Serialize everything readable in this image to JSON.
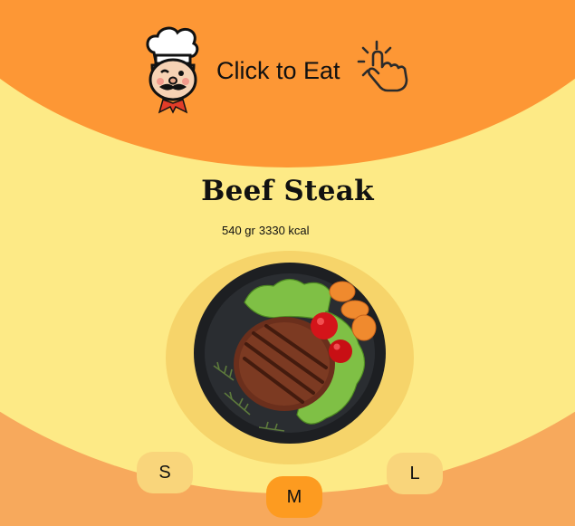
{
  "header": {
    "brand_label": "Click to Eat",
    "logo_icon": "chef-mascot-icon",
    "action_icon": "tap-hand-icon"
  },
  "product": {
    "title": "Beef Steak",
    "weight": "540 gr",
    "calories": "3330 kcal",
    "image_icon": "steak-plate-image"
  },
  "sizes": [
    {
      "label": "S",
      "selected": false
    },
    {
      "label": "M",
      "selected": true
    },
    {
      "label": "L",
      "selected": false
    }
  ],
  "colors": {
    "header_orange": "#fd9735",
    "body_yellow": "#fdea86",
    "bottom_orange": "#f7a95c",
    "selected_size": "#fd9b20",
    "size_button": "#f9d57b"
  }
}
